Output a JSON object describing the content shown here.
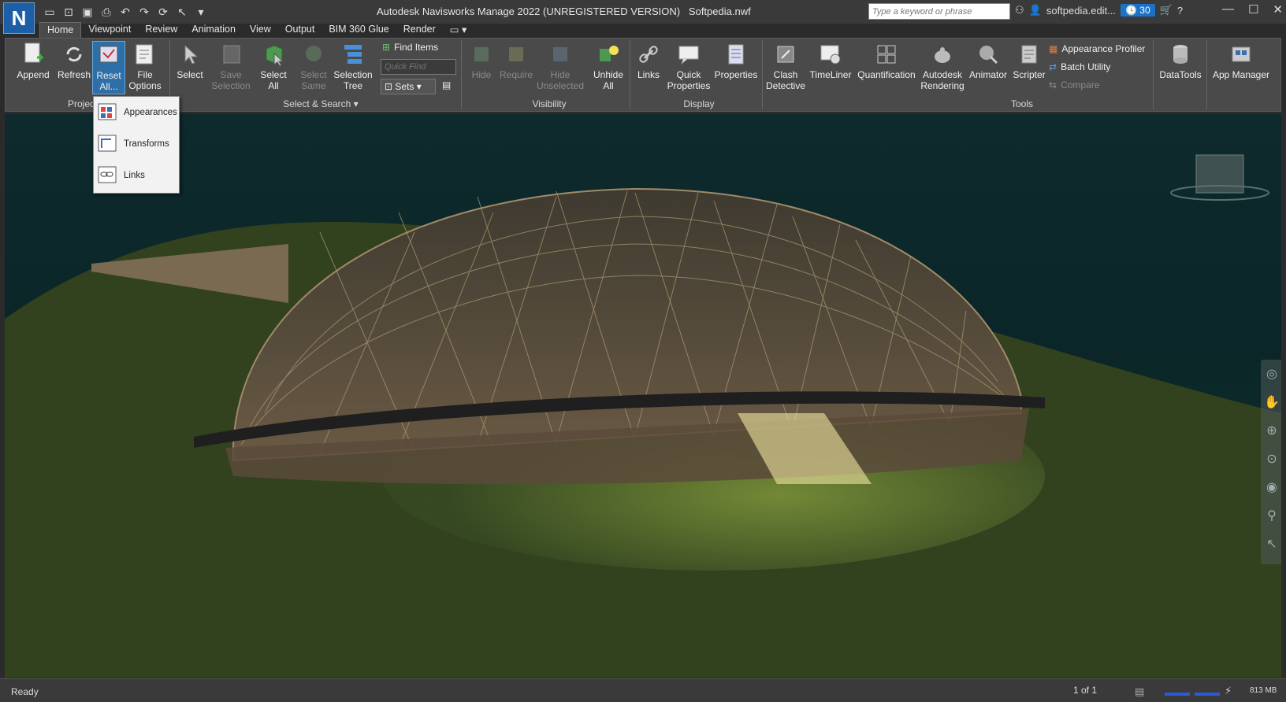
{
  "app": {
    "logo": "N",
    "title": "Autodesk Navisworks Manage 2022 (UNREGISTERED VERSION)",
    "file": "Softpedia.nwf"
  },
  "search": {
    "placeholder": "Type a keyword or phrase"
  },
  "user": {
    "name": "softpedia.edit...",
    "timer": "30"
  },
  "tabs": [
    "Home",
    "Viewpoint",
    "Review",
    "Animation",
    "View",
    "Output",
    "BIM 360 Glue",
    "Render"
  ],
  "ribbon": {
    "append": "Append",
    "refresh": "Refresh",
    "reset_all": "Reset\nAll...",
    "file_options": "File\nOptions",
    "select": "Select",
    "save_selection": "Save\nSelection",
    "select_all": "Select\nAll",
    "select_same": "Select\nSame",
    "selection_tree": "Selection\nTree",
    "find_items": "Find Items",
    "quick_find_placeholder": "Quick Find",
    "sets": "Sets",
    "hide": "Hide",
    "require": "Require",
    "hide_unselected": "Hide\nUnselected",
    "unhide_all": "Unhide\nAll",
    "links": "Links",
    "quick_properties": "Quick\nProperties",
    "properties": "Properties",
    "clash_detective": "Clash\nDetective",
    "timeliner": "TimeLiner",
    "quantification": "Quantification",
    "autodesk_rendering": "Autodesk\nRendering",
    "animator": "Animator",
    "scripter": "Scripter",
    "appearance_profiler": "Appearance Profiler",
    "batch_utility": "Batch Utility",
    "compare": "Compare",
    "datatools": "DataTools",
    "app_manager": "App Manager"
  },
  "groups": {
    "project": "Projec",
    "select_search": "Select & Search",
    "visibility": "Visibility",
    "display": "Display",
    "tools": "Tools"
  },
  "dropdown": [
    "Appearances",
    "Transforms",
    "Links"
  ],
  "status": {
    "text": "Ready",
    "page": "1 of 1",
    "memory": "813 MB"
  },
  "colors": {
    "accent": "#1a73c9",
    "ribbon_bg": "#4a4a4a",
    "titlebar_bg": "#3a3a3a"
  }
}
